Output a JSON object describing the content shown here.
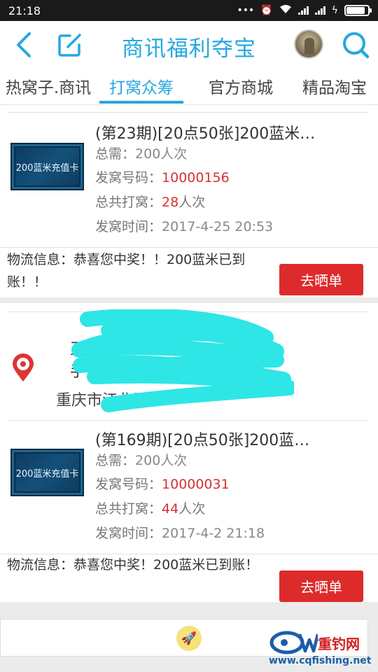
{
  "status_bar": {
    "time": "21:18"
  },
  "header": {
    "title": "商讯福利夺宝"
  },
  "tabs": [
    {
      "label": "热窝子.商讯",
      "active": false
    },
    {
      "label": "打窝众筹",
      "active": true
    },
    {
      "label": "官方商城",
      "active": false
    },
    {
      "label": "精品淘宝",
      "active": false
    }
  ],
  "orders": [
    {
      "title": "(第23期)[20点50张]200蓝米…",
      "image_text": "200蓝米充值卡",
      "need_label": "总需：",
      "need_value": "200人次",
      "number_label": "发窝号码：",
      "number_value": "10000156",
      "total_label": "总共打窝：",
      "total_value": "28",
      "total_unit": "人次",
      "time_label": "发窝时间：",
      "time_value": "2017-4-25 20:53",
      "logistics": "物流信息：恭喜您中奖！！200蓝米已到账！！",
      "button": "去晒单"
    },
    {
      "title": "(第169期)[20点50张]200蓝…",
      "image_text": "200蓝米充值卡",
      "need_label": "总需：",
      "need_value": "200人次",
      "number_label": "发窝号码：",
      "number_value": "10000031",
      "total_label": "总共打窝：",
      "total_value": "44",
      "total_unit": "人次",
      "time_label": "发窝时间：",
      "time_value": "2017-4-2 21:18",
      "logistics": "物流信息：恭喜您中奖！200蓝米已到账！",
      "button": "去晒单"
    }
  ],
  "address": {
    "name_visible": "王",
    "phone_visible": "手",
    "line_visible": "重庆市江北区"
  },
  "watermark": {
    "name": "重钓网",
    "url": "www.cqfishing.net"
  },
  "colors": {
    "accent": "#26a8e0",
    "red": "#dd2b2b",
    "scribble": "#2ee6e6"
  },
  "icons": {
    "back": "chevron-left-icon",
    "edit": "edit-icon",
    "search": "search-icon",
    "location": "map-pin-icon",
    "rocket": "rocket-icon"
  }
}
